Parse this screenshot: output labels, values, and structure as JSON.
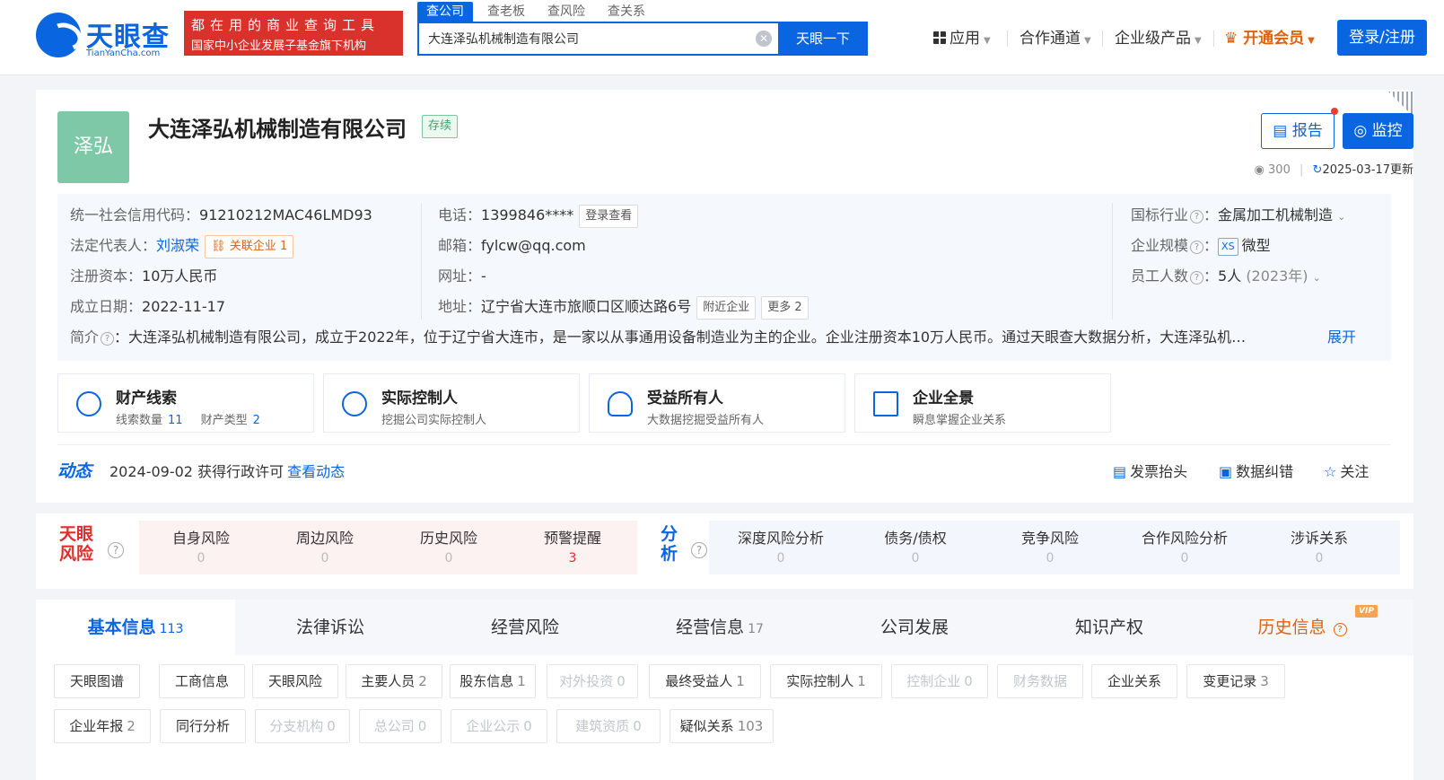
{
  "header": {
    "logo_name": "天眼查",
    "logo_pinyin": "TianYanCha.com",
    "slogan_line1": "都在用的商业查询工具",
    "slogan_line2": "国家中小企业发展子基金旗下机构",
    "search_tabs": [
      "查公司",
      "查老板",
      "查风险",
      "查关系"
    ],
    "search_value": "大连泽弘机械制造有限公司",
    "search_button": "天眼一下",
    "nav": {
      "apps": "应用",
      "channels": "合作通道",
      "enterprise": "企业级产品",
      "vip": "开通会员"
    },
    "login_button": "登录/注册"
  },
  "company": {
    "avatar_text": "泽弘",
    "name": "大连泽弘机械制造有限公司",
    "status": "存续",
    "report_button": "报告",
    "monitor_button": "监控",
    "views": "300",
    "updated": "2025-03-17更新",
    "credit_code_label": "统一社会信用代码：",
    "credit_code": "91210212MAC46LMD93",
    "legal_rep_label": "法定代表人：",
    "legal_rep": "刘淑荣",
    "related_tag": "关联企业 1",
    "capital_label": "注册资本：",
    "capital": "10万人民币",
    "founded_label": "成立日期：",
    "founded": "2022-11-17",
    "phone_label": "电话：",
    "phone": "1399846****",
    "phone_tag": "登录查看",
    "email_label": "邮箱：",
    "email": "fylcw@qq.com",
    "website_label": "网址：",
    "website": "-",
    "address_label": "地址：",
    "address": "辽宁省大连市旅顺口区顺达路6号",
    "nearby_tag": "附近企业",
    "more_tag": "更多 2",
    "industry_label": "国标行业",
    "industry": "金属加工机械制造",
    "scale_label": "企业规模",
    "scale_tag": "XS",
    "scale": "微型",
    "staff_label": "员工人数",
    "staff": "5人",
    "staff_year": "(2023年)",
    "intro_label": "简介",
    "intro": "：大连泽弘机械制造有限公司，成立于2022年，位于辽宁省大连市，是一家以从事通用设备制造业为主的企业。企业注册资本10万人民币。通过天眼查大数据分析，大连泽弘机…",
    "expand": "展开"
  },
  "feature_cards": [
    {
      "title": "财产线索",
      "sub1": "线索数量",
      "num1": "11",
      "sub2": "财产类型",
      "num2": "2"
    },
    {
      "title": "实际控制人",
      "sub": "挖掘公司实际控制人"
    },
    {
      "title": "受益所有人",
      "sub": "大数据挖掘受益所有人"
    },
    {
      "title": "企业全景",
      "sub": "瞬息掌握企业关系"
    }
  ],
  "dynamics": {
    "label": "动态",
    "text": "2024-09-02 获得行政许可",
    "link": "查看动态",
    "actions": [
      "发票抬头",
      "数据纠错",
      "关注"
    ]
  },
  "risk": {
    "logo_line1": "天眼",
    "logo_line2": "风险",
    "items": [
      {
        "label": "自身风险",
        "value": "0"
      },
      {
        "label": "周边风险",
        "value": "0"
      },
      {
        "label": "历史风险",
        "value": "0"
      },
      {
        "label": "预警提醒",
        "value": "3"
      }
    ],
    "analysis_line1": "分",
    "analysis_line2": "析",
    "analysis_items": [
      {
        "label": "深度风险分析",
        "value": "0"
      },
      {
        "label": "债务/债权",
        "value": "0"
      },
      {
        "label": "竞争风险",
        "value": "0"
      },
      {
        "label": "合作风险分析",
        "value": "0"
      },
      {
        "label": "涉诉关系",
        "value": "0"
      }
    ]
  },
  "tabs": [
    {
      "label": "基本信息",
      "count": "113"
    },
    {
      "label": "法律诉讼",
      "count": ""
    },
    {
      "label": "经营风险",
      "count": ""
    },
    {
      "label": "经营信息",
      "count": "17"
    },
    {
      "label": "公司发展",
      "count": ""
    },
    {
      "label": "知识产权",
      "count": ""
    },
    {
      "label": "历史信息",
      "count": ""
    }
  ],
  "vip_badge": "VIP",
  "sub_tags": [
    {
      "label": "天眼图谱",
      "count": ""
    },
    {
      "label": "工商信息",
      "count": ""
    },
    {
      "label": "天眼风险",
      "count": ""
    },
    {
      "label": "主要人员",
      "count": "2"
    },
    {
      "label": "股东信息",
      "count": "1"
    },
    {
      "label": "对外投资",
      "count": "0"
    },
    {
      "label": "最终受益人",
      "count": "1"
    },
    {
      "label": "实际控制人",
      "count": "1"
    },
    {
      "label": "控制企业",
      "count": "0"
    },
    {
      "label": "财务数据",
      "count": ""
    },
    {
      "label": "企业关系",
      "count": ""
    },
    {
      "label": "变更记录",
      "count": "3"
    },
    {
      "label": "企业年报",
      "count": "2"
    },
    {
      "label": "同行分析",
      "count": ""
    },
    {
      "label": "分支机构",
      "count": "0"
    },
    {
      "label": "总公司",
      "count": "0"
    },
    {
      "label": "企业公示",
      "count": "0"
    },
    {
      "label": "建筑资质",
      "count": "0"
    },
    {
      "label": "疑似关系",
      "count": "103"
    }
  ]
}
